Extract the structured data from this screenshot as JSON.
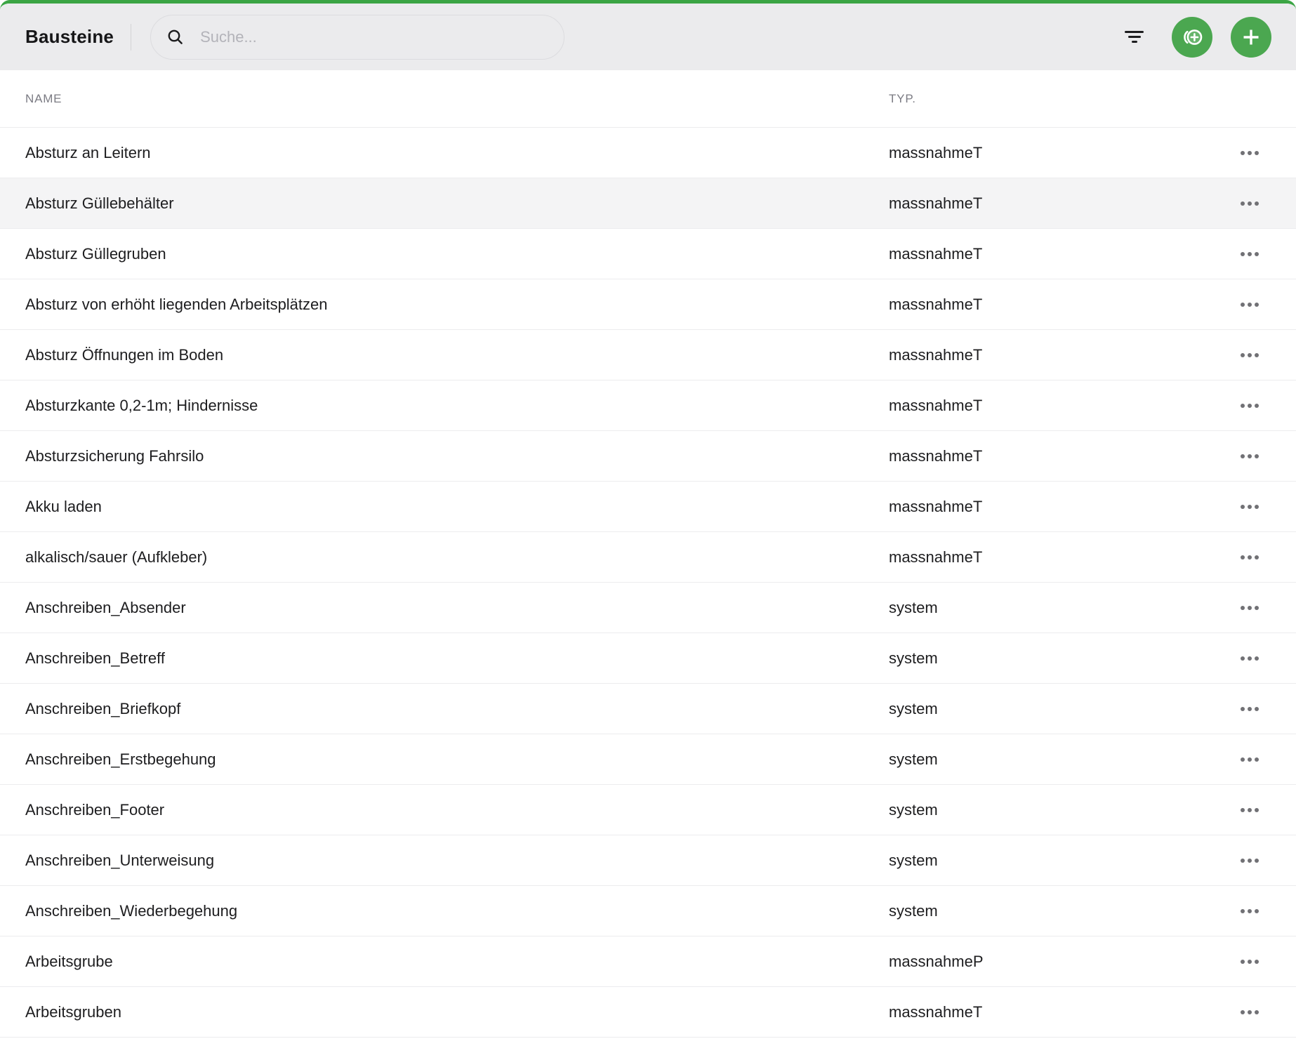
{
  "header": {
    "title": "Bausteine",
    "search": {
      "placeholder": "Suche...",
      "value": ""
    }
  },
  "colors": {
    "accent_green": "#4BA750",
    "top_line_green": "#3BA544",
    "header_bg": "#ebebed",
    "row_highlight_bg": "#f4f4f5",
    "row_border": "#ececee",
    "muted_label": "#7b7b83"
  },
  "table": {
    "columns": [
      "NAME",
      "TYP."
    ],
    "rows": [
      {
        "name": "Absturz an Leitern",
        "type": "massnahmeT",
        "highlighted": false
      },
      {
        "name": "Absturz Güllebehälter",
        "type": "massnahmeT",
        "highlighted": true
      },
      {
        "name": "Absturz Güllegruben",
        "type": "massnahmeT",
        "highlighted": false
      },
      {
        "name": "Absturz von erhöht liegenden Arbeitsplätzen",
        "type": "massnahmeT",
        "highlighted": false
      },
      {
        "name": "Absturz Öffnungen im Boden",
        "type": "massnahmeT",
        "highlighted": false
      },
      {
        "name": "Absturzkante 0,2-1m; Hindernisse",
        "type": "massnahmeT",
        "highlighted": false
      },
      {
        "name": "Absturzsicherung Fahrsilo",
        "type": "massnahmeT",
        "highlighted": false
      },
      {
        "name": "Akku laden",
        "type": "massnahmeT",
        "highlighted": false
      },
      {
        "name": "alkalisch/sauer (Aufkleber)",
        "type": "massnahmeT",
        "highlighted": false
      },
      {
        "name": "Anschreiben_Absender",
        "type": "system",
        "highlighted": false
      },
      {
        "name": "Anschreiben_Betreff",
        "type": "system",
        "highlighted": false
      },
      {
        "name": "Anschreiben_Briefkopf",
        "type": "system",
        "highlighted": false
      },
      {
        "name": "Anschreiben_Erstbegehung",
        "type": "system",
        "highlighted": false
      },
      {
        "name": "Anschreiben_Footer",
        "type": "system",
        "highlighted": false
      },
      {
        "name": "Anschreiben_Unterweisung",
        "type": "system",
        "highlighted": false
      },
      {
        "name": "Anschreiben_Wiederbegehung",
        "type": "system",
        "highlighted": false
      },
      {
        "name": "Arbeitsgrube",
        "type": "massnahmeP",
        "highlighted": false
      },
      {
        "name": "Arbeitsgruben",
        "type": "massnahmeT",
        "highlighted": false
      }
    ]
  }
}
